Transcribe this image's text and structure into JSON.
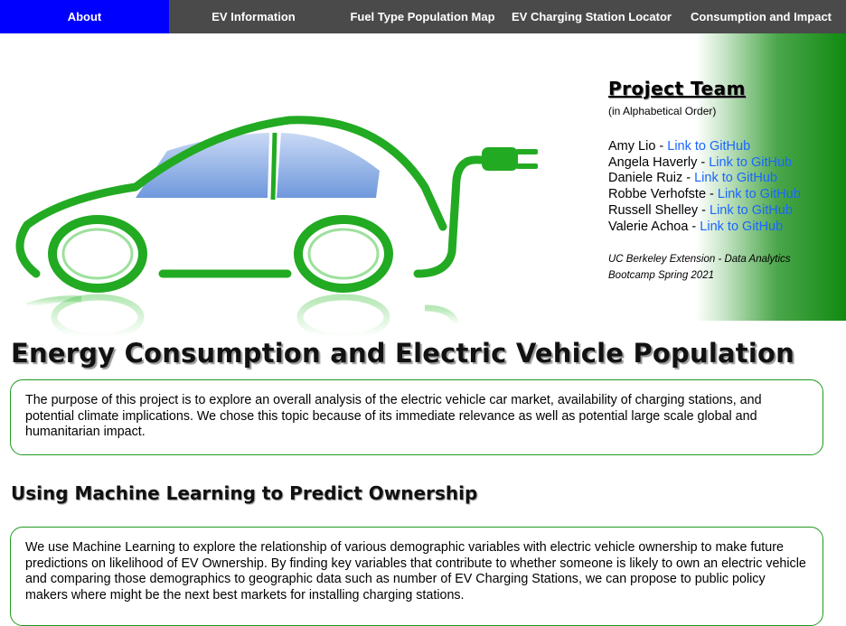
{
  "nav": {
    "items": [
      {
        "label": "About",
        "active": true
      },
      {
        "label": "EV Information",
        "active": false
      },
      {
        "label": "Fuel Type Population Map",
        "active": false
      },
      {
        "label": "EV Charging Station Locator",
        "active": false
      },
      {
        "label": "Consumption and Impact",
        "active": false
      }
    ]
  },
  "hero": {
    "image_icon": "electric-car-plug-icon",
    "accent_color": "#22aa22"
  },
  "team": {
    "title": "Project Team",
    "subtitle": "(in Alphabetical Order)",
    "members": [
      {
        "name": "Amy Lio - ",
        "link": "Link to GitHub"
      },
      {
        "name": "Angela Haverly - ",
        "link": "Link to GitHub"
      },
      {
        "name": "Daniele Ruiz - ",
        "link": "Link to GitHub"
      },
      {
        "name": "Robbe Verhofste - ",
        "link": "Link to GitHub"
      },
      {
        "name": "Russell Shelley - ",
        "link": "Link to GitHub"
      },
      {
        "name": "Valerie Achoa - ",
        "link": "Link to GitHub"
      }
    ],
    "credit_line1": "UC Berkeley Extension - Data Analytics",
    "credit_line2": "Bootcamp Spring 2021"
  },
  "main": {
    "title": "Energy Consumption and Electric Vehicle Population",
    "purpose": "The purpose of this project is to explore an overall analysis of the electric vehicle car market, availability of charging stations, and potential climate implications. We chose this topic because of its immediate relevance as well as potential large scale global and humanitarian impact.",
    "ml_title": "Using Machine Learning to Predict Ownership",
    "ml_text": "We use Machine Learning to explore the relationship of various demographic variables with electric vehicle ownership to make future predictions on likelihood of EV Ownership. By finding key variables that contribute to whether someone is likely to own an electric vehicle and comparing those demographics to geographic data such as number of EV Charging Stations, we can propose to public policy makers where might be the next best markets for installing charging stations."
  },
  "colors": {
    "nav_bg": "#4a4a4a",
    "nav_active": "#0000ff",
    "link": "#1a66ff",
    "box_border": "#1f9a1f"
  }
}
